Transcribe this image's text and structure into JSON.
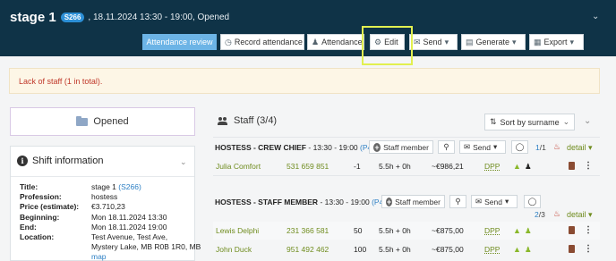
{
  "header": {
    "title": "stage 1",
    "badge": "S266",
    "meta": ", 18.11.2024 13:30 - 19:00, Opened"
  },
  "toolbar": {
    "attendance_review": "Attendance review",
    "record_attendance": "Record attendance",
    "attendance": "Attendance",
    "edit": "Edit",
    "send": "Send",
    "generate": "Generate",
    "export": "Export"
  },
  "alert": {
    "text": "Lack of staff (1 in total)."
  },
  "status": {
    "label": "Opened"
  },
  "shift_info": {
    "title": "Shift information",
    "fields": [
      {
        "k": "Title:",
        "v": "stage 1",
        "extra": "(S266)"
      },
      {
        "k": "Profession:",
        "v": "hostess"
      },
      {
        "k": "Price (estimate):",
        "v": "€3.710,23"
      },
      {
        "k": "Beginning:",
        "v": "Mon 18.11.2024 13:30"
      },
      {
        "k": "End:",
        "v": "Mon 18.11.2024 19:00"
      },
      {
        "k": "Location:",
        "v": "Test Avenue, Test Ave,"
      }
    ],
    "location_line2": "Mystery Lake, MB R0B 1R0, MB",
    "location_line3": "map"
  },
  "staff": {
    "title": "Staff (3/4)",
    "sort_label": "Sort by surname",
    "staff_member_btn": "Staff member",
    "send_btn": "Send",
    "detail": "detail",
    "groups": [
      {
        "title": "HOSTESS - CREW CHIEF",
        "time": " - 13:30 - 19:00 ",
        "code": "(P441)",
        "pager_hi": "1",
        "pager_rest": "/1",
        "rows": [
          {
            "name": "Julia Comfort",
            "phone": "531 659 851",
            "num": "-1",
            "hours": "5.5h + 0h",
            "price": "~€986,21",
            "dpp": "DPP"
          }
        ]
      },
      {
        "title": "HOSTESS - STAFF MEMBER",
        "time": " - 13:30 - 19:00 ",
        "code": "(P442)",
        "pager_hi": "2",
        "pager_rest": "/3",
        "rows": [
          {
            "name": "Lewis Delphi",
            "phone": "231 366 581",
            "num": "50",
            "hours": "5.5h + 0h",
            "price": "~€875,00",
            "dpp": "DPP"
          },
          {
            "name": "John Duck",
            "phone": "951 492 462",
            "num": "100",
            "hours": "5.5h + 0h",
            "price": "~€875,00",
            "dpp": "DPP"
          }
        ]
      }
    ]
  },
  "colors": {
    "header_bg": "#0f3347",
    "primary": "#6cb4e6",
    "highlight": "#e2f050",
    "alert_text": "#c0392b",
    "green": "#6f8c1e"
  }
}
